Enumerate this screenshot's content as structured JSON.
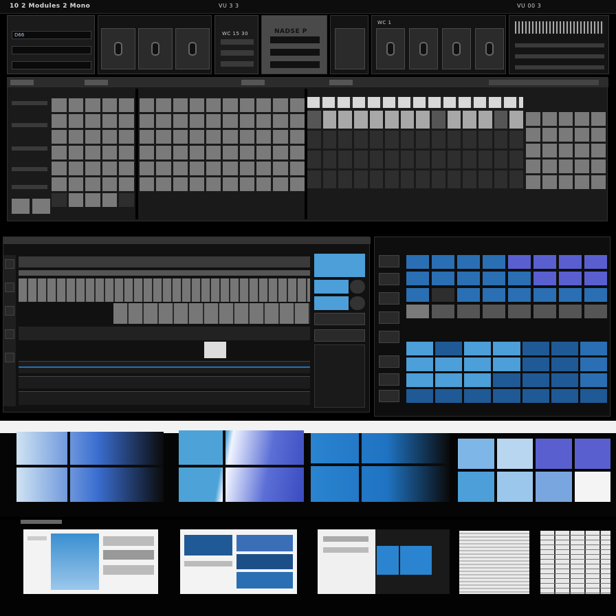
{
  "topbar": {
    "title": "10 2 Modules 2 Mono",
    "center_label": "VU 3 3",
    "right_label": "VU 00 3"
  },
  "rack": {
    "screen_line_1": "D66",
    "screen_line_2": "",
    "screen_line_3": "",
    "display_label": "WC 15 30",
    "center_label": "NADSE P",
    "right_label": "WC 1"
  },
  "sequencer": {
    "header_left": "",
    "header_mid": "",
    "row_labels": [
      "",
      "",
      "",
      "",
      ""
    ]
  },
  "editor": {
    "title": "",
    "subtitle": ""
  },
  "mixer": {
    "title": "",
    "footer": ""
  },
  "gallery": {
    "captions": [
      "",
      "",
      "",
      ""
    ],
    "bottom_labels": [
      "",
      "",
      "",
      ""
    ]
  }
}
